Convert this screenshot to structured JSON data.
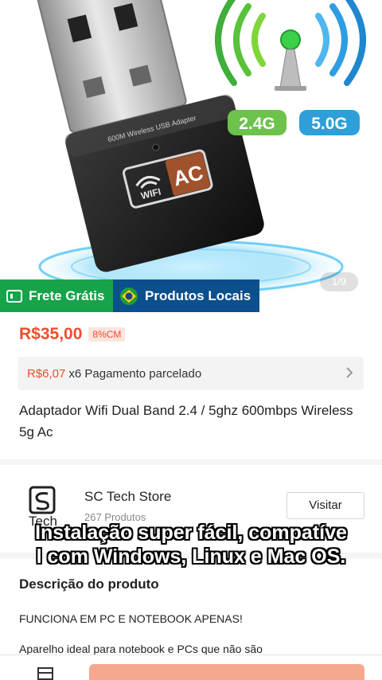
{
  "gallery": {
    "counter": "1/9",
    "adapter_label": "600M Wireless USB Adapter",
    "wifi_text": "WIFI",
    "ac_text": "AC",
    "band_24": "2.4G",
    "band_5": "5.0G"
  },
  "badges": {
    "frete": "Frete Grátis",
    "local": "Produtos Locais"
  },
  "product": {
    "price": "R$35,00",
    "tax": "8%CM",
    "installment_price": "R$6,07",
    "installment_rest": "x6 Pagamento parcelado",
    "title": "Adaptador Wifi Dual Band 2.4 / 5ghz 600mbps Wireless 5g Ac"
  },
  "store": {
    "name": "SC Tech Store",
    "products": "267 Produtos",
    "visit": "Visitar",
    "logo_text": "Tech"
  },
  "description": {
    "heading": "Descrição do produto",
    "line1": "FUNCIONA EM PC E NOTEBOOK APENAS!",
    "line2": "Aparelho ideal para notebook e PCs que não são"
  },
  "caption": {
    "line1": "Instalação super fácil, compatíve",
    "line2": "l com Windows, Linux e Mac OS."
  },
  "colors": {
    "accent": "#ee4d2d",
    "frete_green": "#16a34a",
    "local_blue": "#0b4f8c"
  }
}
